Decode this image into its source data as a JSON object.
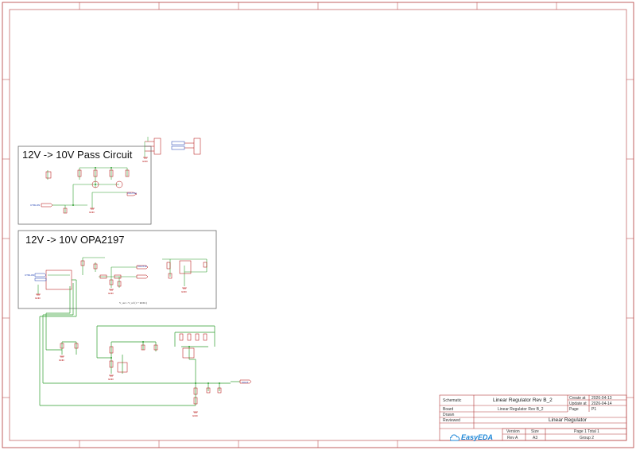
{
  "sheet": {
    "border_color": "#b33a3a",
    "wire_color": "#2e9e2e",
    "part_color": "#b00000",
    "net_color": "#1a3cb0"
  },
  "boxes": {
    "pass_title": "12V -> 10V Pass Circuit",
    "opa_title": "12V -> 10V OPA2197"
  },
  "nets": {
    "vout12": "VOUT12",
    "vout10": "VOUT10",
    "vout": "VOUT",
    "gnd": "GND",
    "ctrl": "CTRLON"
  },
  "title_block": {
    "schematic_label": "Schematic",
    "schematic_value": "Linear Regulator Rev B_2",
    "board_label": "Board",
    "board_value": "Linear Regulator Rev B_2",
    "drawn_label": "Drawn",
    "reviewed_label": "Reviewed",
    "create_label": "Create at",
    "create_value": "2026-04-13",
    "update_label": "Update at",
    "update_value": "2026-04-14",
    "page_label": "Page",
    "page_value": "P1",
    "title": "Linear Regulator",
    "version_label": "Version",
    "version_value": "Rev A",
    "size_label": "Size",
    "size_value": "A3",
    "page_total": "Page 1  Total 1",
    "group": "Group 2",
    "logo_text": "EasyEDA"
  }
}
